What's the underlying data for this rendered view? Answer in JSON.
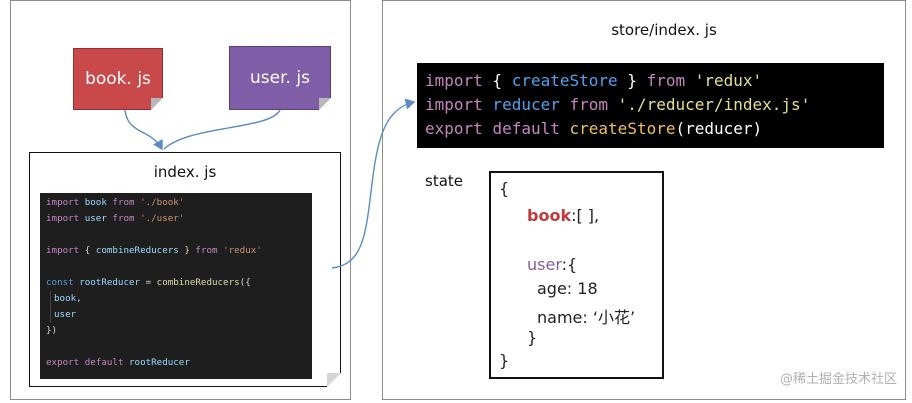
{
  "left": {
    "book_note": "book. js",
    "user_note": "user. js",
    "index_title": "index. js",
    "code": {
      "l1": [
        "import",
        " book ",
        "from",
        " './book'"
      ],
      "l2": [
        "import",
        " user ",
        "from",
        " './user'"
      ],
      "l3": [
        "import",
        " { ",
        "combineReducers",
        " } ",
        "from",
        " 'redux'"
      ],
      "l4": [
        "const",
        " rootReducer",
        " = ",
        "combineReducers",
        "({"
      ],
      "l5": "book,",
      "l6": "user",
      "l7": "})",
      "l8": [
        "export",
        " ",
        "default",
        " rootReducer"
      ]
    }
  },
  "right": {
    "store_title": "store/index. js",
    "store_code": {
      "l1": [
        "import",
        " { ",
        "createStore",
        " } ",
        "from",
        " 'redux'"
      ],
      "l2": [
        "import",
        " reducer ",
        "from",
        " './reducer/index.js'"
      ],
      "l3": [
        "export",
        " ",
        "default",
        " ",
        "createStore",
        "(reducer)"
      ]
    },
    "state_label": "state",
    "state": {
      "open": "{",
      "book_key": "book",
      "book_val": ":[ ],",
      "user_key": "user",
      "user_val": ":{",
      "age": "age: 18",
      "name": "name: ‘小花’",
      "inner_close": "}",
      "close": "}"
    }
  },
  "watermark": "@稀土掘金技术社区"
}
